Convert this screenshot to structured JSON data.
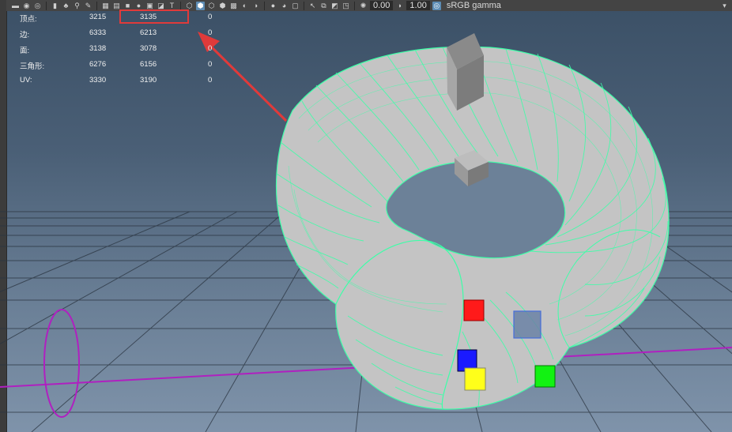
{
  "toolbar": {
    "icons": [
      "camera-icon",
      "camera-attr-icon",
      "camera-lock-icon",
      "bookmark-icon",
      "sculpt-icon",
      "select-camera-icon",
      "paint-icon",
      "grid-icon",
      "film-gate-icon",
      "resolution-gate-icon",
      "gate-mask-icon",
      "field-chart-icon",
      "safe-action-icon",
      "safe-title-icon",
      "wireframe-icon",
      "smooth-shade-icon",
      "wireframe-on-shaded-icon",
      "textured-icon",
      "lights-icon",
      "shadows-icon",
      "ambient-occlusion-icon",
      "motion-blur-icon",
      "anti-alias-icon",
      "depth-of-field-icon",
      "xray-icon",
      "xray-joints-icon",
      "xray-components-icon",
      "isolate-icon",
      "exposure-icon",
      "gamma-icon",
      "color-management-icon"
    ],
    "exposure_value": "0.00",
    "gamma_value": "1.00",
    "color_space": "sRGB gamma"
  },
  "hud": {
    "rows": [
      {
        "label": "顶点:",
        "v1": "3215",
        "v2": "3135",
        "v3": "0"
      },
      {
        "label": "边:",
        "v1": "6333",
        "v2": "6213",
        "v3": "0"
      },
      {
        "label": "面:",
        "v1": "3138",
        "v2": "3078",
        "v3": "0"
      },
      {
        "label": "三角形:",
        "v1": "6276",
        "v2": "6156",
        "v3": "0"
      },
      {
        "label": "UV:",
        "v1": "3330",
        "v2": "3190",
        "v3": "0"
      }
    ]
  },
  "colors": {
    "wire": "#3dffa8",
    "surface": "#c4c4c4",
    "annotation": "#e03a3a",
    "curve": "#b020c0"
  }
}
